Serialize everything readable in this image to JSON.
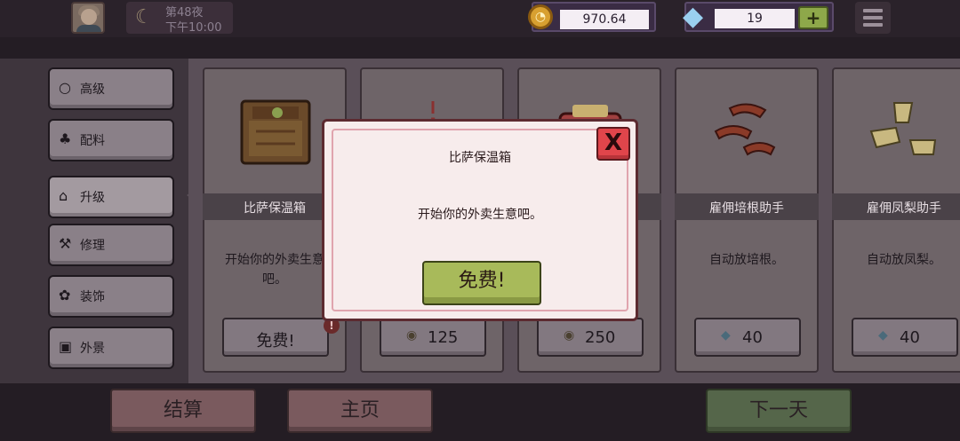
{
  "topbar": {
    "day_label": "第48夜",
    "time_label": "下午10:00",
    "coins": "970.64",
    "gems": "19",
    "plus": "+"
  },
  "sidebar": {
    "items": [
      {
        "label": "高级",
        "icon": "○"
      },
      {
        "label": "配料",
        "icon": "♣"
      },
      {
        "label": "升级",
        "icon": "⌂"
      },
      {
        "label": "修理",
        "icon": "⚒"
      },
      {
        "label": "装饰",
        "icon": "✿"
      },
      {
        "label": "外景",
        "icon": "▣"
      }
    ]
  },
  "cards": [
    {
      "name": "比萨保温箱",
      "desc": "开始你的外卖生意吧。",
      "price": "免费!",
      "badge": "!"
    },
    {
      "name": "",
      "desc": "",
      "price": "125",
      "currency": "coin"
    },
    {
      "name": "",
      "desc": "",
      "price": "250",
      "currency": "coin"
    },
    {
      "name": "雇佣培根助手",
      "desc": "自动放培根。",
      "price": "40",
      "currency": "gem"
    },
    {
      "name": "雇佣凤梨助手",
      "desc": "自动放凤梨。",
      "price": "40",
      "currency": "gem"
    }
  ],
  "bottom": {
    "settle": "结算",
    "home": "主页",
    "next_day": "下一天"
  },
  "dialog": {
    "title": "比萨保温箱",
    "message": "开始你的外卖生意吧。",
    "confirm": "免费!",
    "close": "X"
  }
}
